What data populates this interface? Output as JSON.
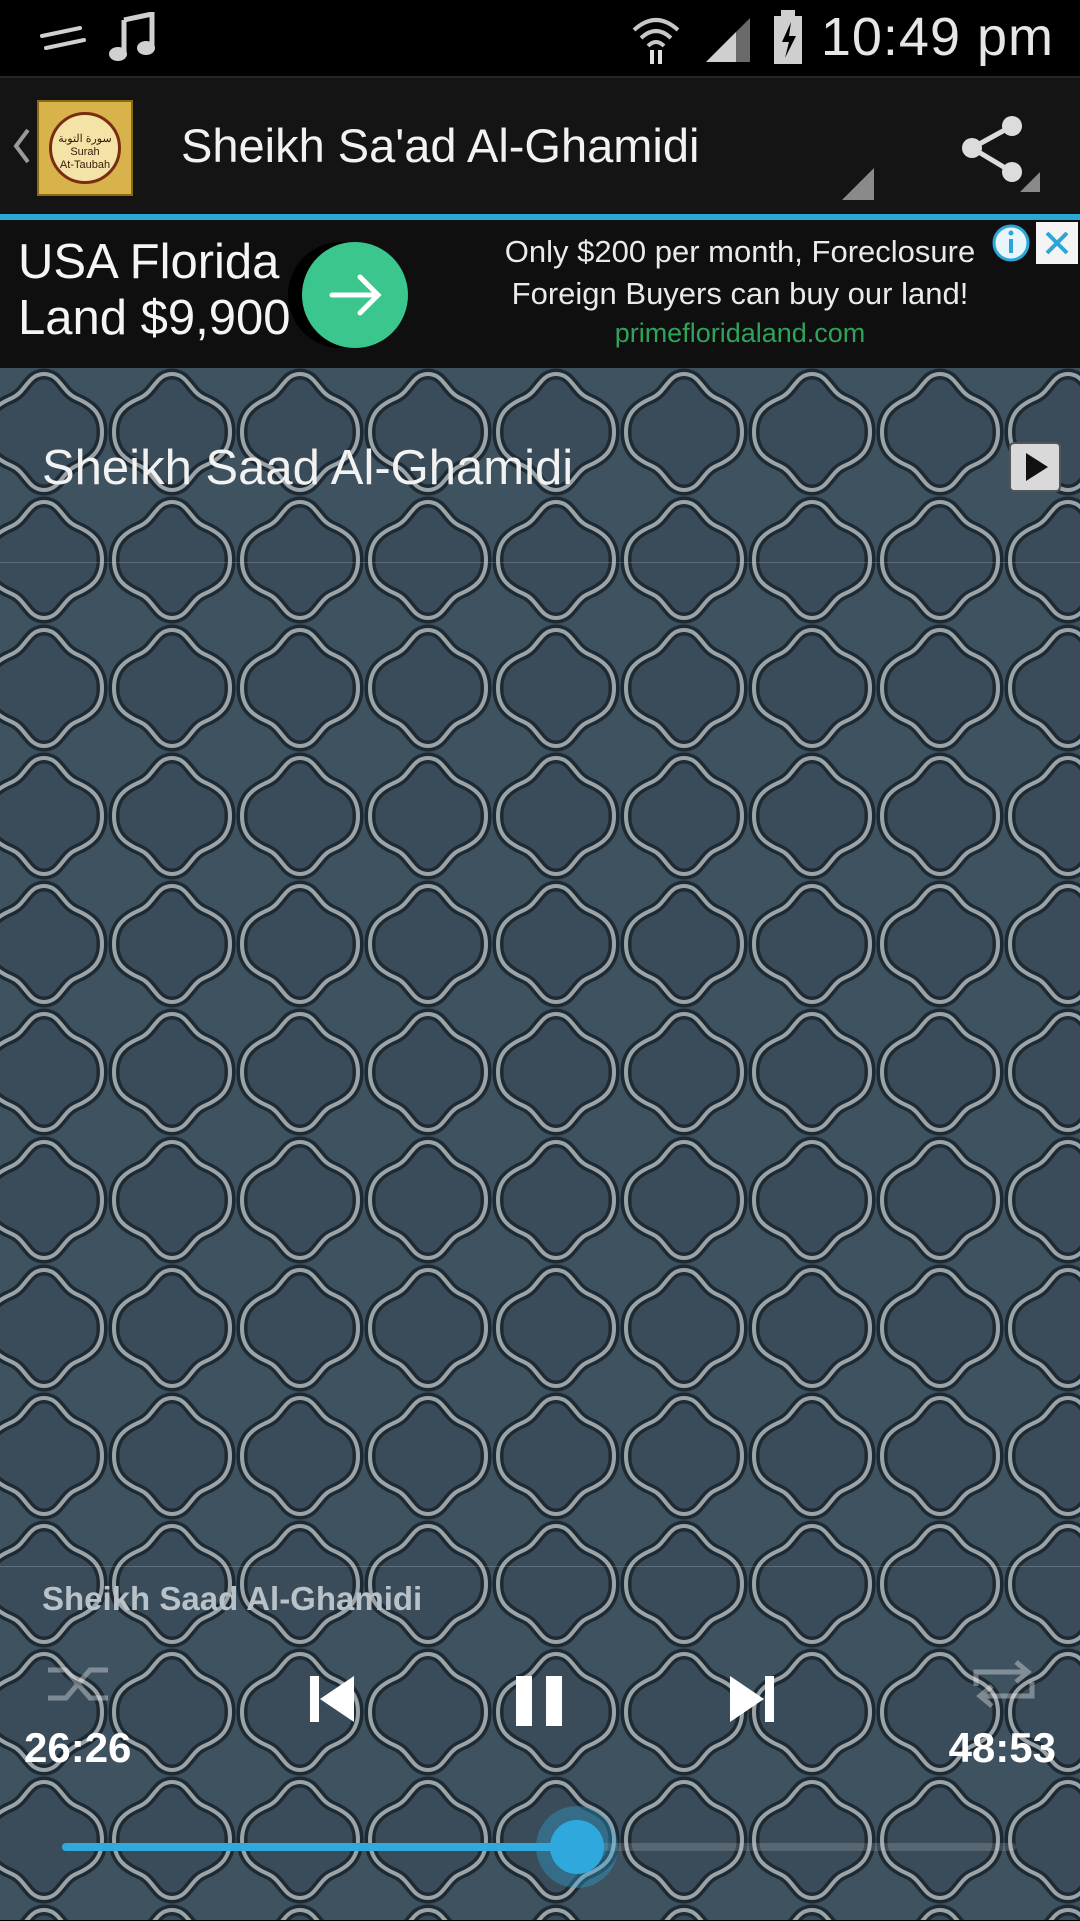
{
  "status_bar": {
    "time": "10:49 pm"
  },
  "action_bar": {
    "title": "Sheikh Sa'ad Al-Ghamidi",
    "app_icon_arabic": "سورة التوبة",
    "app_icon_line1": "Surah",
    "app_icon_line2": "At-Taubah"
  },
  "ad": {
    "headline": "USA Florida Land $9,900",
    "line1": "Only $200 per month, Foreclosure",
    "line2": "Foreign Buyers can buy our land!",
    "url": "primefloridaland.com"
  },
  "track_list": {
    "items": [
      {
        "label": "Sheikh Saad Al-Ghamidi"
      }
    ]
  },
  "player": {
    "now_playing": "Sheikh Saad Al-Ghamidi",
    "current_time": "26:26",
    "total_time": "48:53",
    "progress": 0.54
  },
  "colors": {
    "accent": "#2ba6d6",
    "background_pattern": "#3f5260",
    "ad_button": "#3bc68e",
    "ad_url": "#2fa35a"
  },
  "icons": {
    "status": [
      "signal-icon",
      "music-note-icon",
      "wifi-icon",
      "cell-signal-icon",
      "battery-charging-icon"
    ],
    "action_bar": [
      "back-icon",
      "share-icon"
    ],
    "player": [
      "shuffle-icon",
      "previous-icon",
      "pause-icon",
      "next-icon",
      "repeat-icon"
    ]
  }
}
